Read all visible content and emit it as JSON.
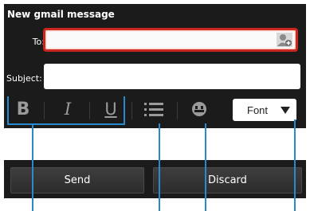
{
  "title": "New gmail message",
  "fields": {
    "to_label": "To:",
    "to_value": "",
    "subject_label": "Subject:",
    "subject_value": ""
  },
  "toolbar": {
    "bold": "B",
    "italic": "I",
    "underline": "U",
    "font_label": "Font"
  },
  "actions": {
    "send": "Send",
    "discard": "Discard"
  },
  "colors": {
    "panel": "#1b1b1b",
    "to_field_border": "#c8281e",
    "callout": "#2a8ad0"
  },
  "icons": [
    "add-contact-icon",
    "bulleted-list-icon",
    "emoticon-icon",
    "dropdown-arrow-icon"
  ]
}
